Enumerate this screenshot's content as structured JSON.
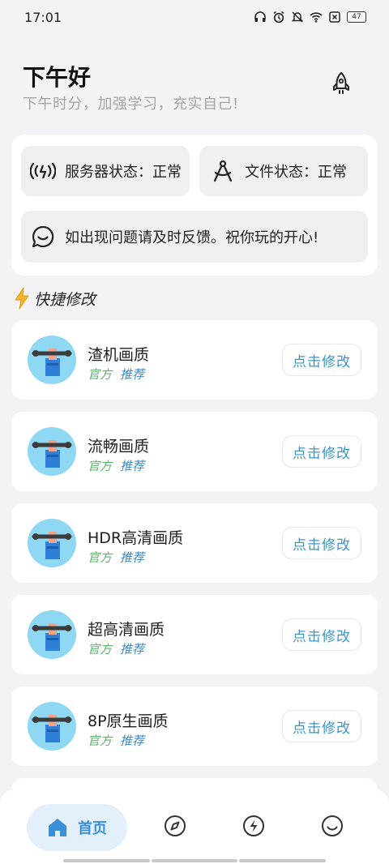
{
  "status_bar": {
    "time": "17:01",
    "battery": "47",
    "icons": [
      "headphones-icon",
      "alarm-icon",
      "mute-icon",
      "wifi-icon",
      "sim-blocked-icon",
      "battery-icon"
    ]
  },
  "header": {
    "greeting": "下午好",
    "subtitle": "下午时分，加强学习，充实自己!",
    "action_icon": "rocket-icon"
  },
  "status_card": {
    "server_status": "服务器状态：正常",
    "file_status": "文件状态：正常",
    "feedback": "如出现问题请及时反馈。祝你玩的开心!"
  },
  "quick_section": {
    "title": "快捷修改",
    "items": [
      {
        "title": "渣机画质",
        "tag_official": "官方",
        "tag_recommend": "推荐",
        "button": "点击修改"
      },
      {
        "title": "流畅画质",
        "tag_official": "官方",
        "tag_recommend": "推荐",
        "button": "点击修改"
      },
      {
        "title": "HDR高清画质",
        "tag_official": "官方",
        "tag_recommend": "推荐",
        "button": "点击修改"
      },
      {
        "title": "超高清画质",
        "tag_official": "官方",
        "tag_recommend": "推荐",
        "button": "点击修改"
      },
      {
        "title": "8P原生画质",
        "tag_official": "官方",
        "tag_recommend": "推荐",
        "button": "点击修改"
      }
    ]
  },
  "bottom_nav": {
    "home_label": "首页",
    "items": [
      "home-icon",
      "compass-icon",
      "lightning-icon",
      "smile-icon"
    ]
  },
  "colors": {
    "accent_blue": "#3b8fd6",
    "tag_green": "#58b46a",
    "tag_blue": "#3c8bc7",
    "background": "#f3f3f5"
  }
}
